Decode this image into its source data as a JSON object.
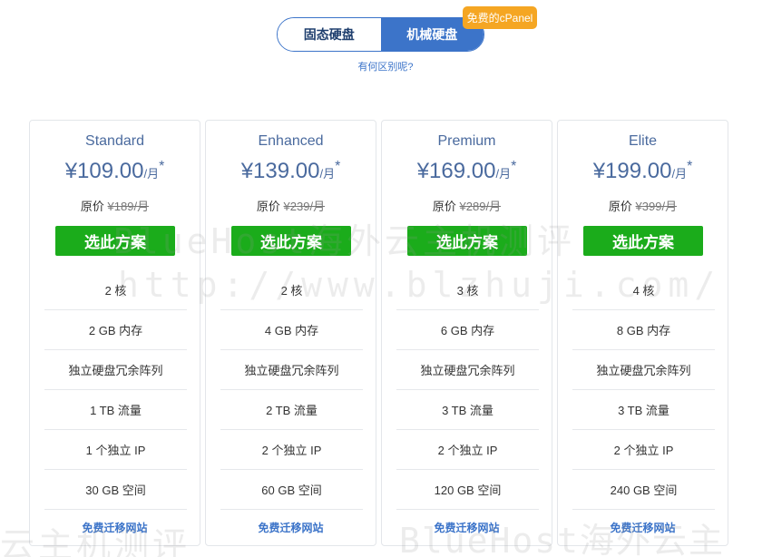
{
  "toggle": {
    "ssd_label": "固态硬盘",
    "hdd_label": "机械硬盘",
    "active": "hdd",
    "badge": "免费的cPanel",
    "diff_link": "有何区别呢?"
  },
  "plans": [
    {
      "name": "Standard",
      "currency": "¥",
      "price": "109.00",
      "per": "/月",
      "star": "*",
      "orig_label": "原价",
      "orig_price": "¥189/月",
      "button": "选此方案",
      "features": [
        "2 核",
        "2 GB 内存",
        "独立硬盘冗余阵列",
        "1 TB 流量",
        "1 个独立 IP",
        "30 GB 空间"
      ],
      "migrate": "免费迁移网站"
    },
    {
      "name": "Enhanced",
      "currency": "¥",
      "price": "139.00",
      "per": "/月",
      "star": "*",
      "orig_label": "原价",
      "orig_price": "¥239/月",
      "button": "选此方案",
      "features": [
        "2 核",
        "4 GB 内存",
        "独立硬盘冗余阵列",
        "2 TB 流量",
        "2 个独立 IP",
        "60 GB 空间"
      ],
      "migrate": "免费迁移网站"
    },
    {
      "name": "Premium",
      "currency": "¥",
      "price": "169.00",
      "per": "/月",
      "star": "*",
      "orig_label": "原价",
      "orig_price": "¥289/月",
      "button": "选此方案",
      "features": [
        "3 核",
        "6 GB 内存",
        "独立硬盘冗余阵列",
        "3 TB 流量",
        "2 个独立 IP",
        "120 GB 空间"
      ],
      "migrate": "免费迁移网站"
    },
    {
      "name": "Elite",
      "currency": "¥",
      "price": "199.00",
      "per": "/月",
      "star": "*",
      "orig_label": "原价",
      "orig_price": "¥399/月",
      "button": "选此方案",
      "features": [
        "4 核",
        "8 GB 内存",
        "独立硬盘冗余阵列",
        "3 TB 流量",
        "2 个独立 IP",
        "240 GB 空间"
      ],
      "migrate": "免费迁移网站"
    }
  ],
  "watermark": {
    "line1": "BlueHost海外云主机测评",
    "line2": "http://www.blzhuji.com/",
    "line3": "云主机测评",
    "line4": "BlueHost海外云主"
  }
}
